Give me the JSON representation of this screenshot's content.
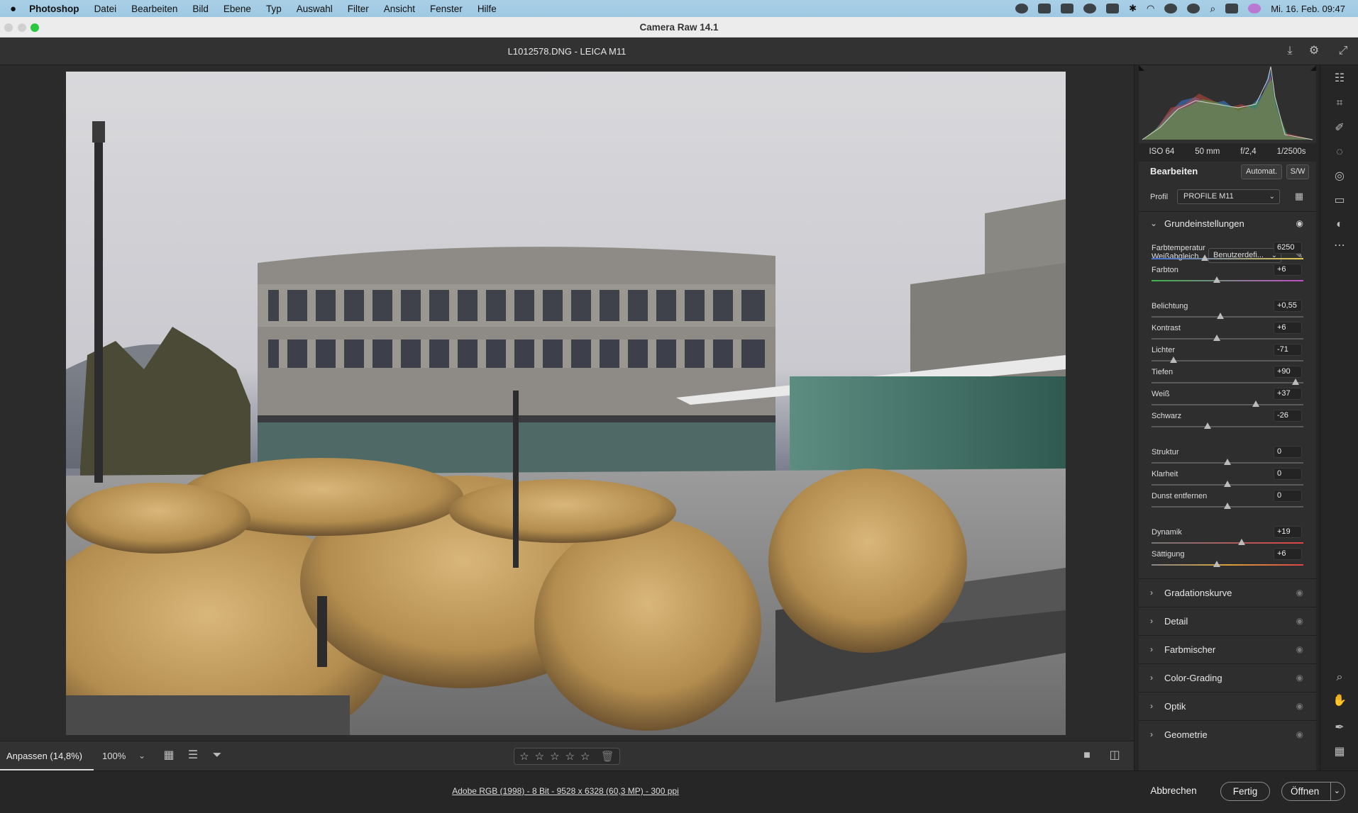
{
  "menubar": {
    "apple_icon": "apple-icon",
    "items": [
      "Photoshop",
      "Datei",
      "Bearbeiten",
      "Bild",
      "Ebene",
      "Typ",
      "Auswahl",
      "Filter",
      "Ansicht",
      "Fenster",
      "Hilfe"
    ],
    "clock": "Mi. 16. Feb.  09:47"
  },
  "window": {
    "title": "Camera Raw 14.1"
  },
  "filebar": {
    "filename": "L1012578.DNG  -  LEICA M11"
  },
  "exif": {
    "iso": "ISO 64",
    "focal": "50 mm",
    "aperture": "f/2,4",
    "shutter": "1/2500s"
  },
  "edit": {
    "title": "Bearbeiten",
    "auto_label": "Automat.",
    "bw_label": "S/W",
    "profile_label": "Profil",
    "profile_value": "PROFILE M11",
    "basic_title": "Grundeinstellungen",
    "wb_label": "Weißabgleich",
    "wb_value": "Benutzerdefi...",
    "sliders": [
      {
        "label": "Farbtemperatur",
        "value": "6250",
        "pos": 0.35
      },
      {
        "label": "Farbton",
        "value": "+6",
        "pos": 0.43
      },
      {
        "label": "Belichtung",
        "value": "+0,55",
        "pos": 0.455
      },
      {
        "label": "Kontrast",
        "value": "+6",
        "pos": 0.43
      },
      {
        "label": "Lichter",
        "value": "-71",
        "pos": 0.145
      },
      {
        "label": "Tiefen",
        "value": "+90",
        "pos": 0.95
      },
      {
        "label": "Weiß",
        "value": "+37",
        "pos": 0.685
      },
      {
        "label": "Schwarz",
        "value": "-26",
        "pos": 0.37
      },
      {
        "label": "Struktur",
        "value": "0",
        "pos": 0.5
      },
      {
        "label": "Klarheit",
        "value": "0",
        "pos": 0.5
      },
      {
        "label": "Dunst entfernen",
        "value": "0",
        "pos": 0.5
      },
      {
        "label": "Dynamik",
        "value": "+19",
        "pos": 0.595
      },
      {
        "label": "Sättigung",
        "value": "+6",
        "pos": 0.43
      }
    ],
    "sections": [
      "Gradationskurve",
      "Detail",
      "Farbmischer",
      "Color-Grading",
      "Optik",
      "Geometrie"
    ]
  },
  "bottombar": {
    "zoom_fit": "Anpassen (14,8%)",
    "zoom_100": "100%",
    "rating": "☆☆☆☆☆"
  },
  "statusbar": {
    "info": "Adobe RGB (1998) - 8 Bit - 9528 x 6328 (60,3 MP) - 300 ppi",
    "cancel": "Abbrechen",
    "done": "Fertig",
    "open": "Öffnen"
  },
  "colors": {
    "accent": "#dddddd",
    "panel": "#2e2e2e",
    "menubar": "#a3cbe4"
  }
}
